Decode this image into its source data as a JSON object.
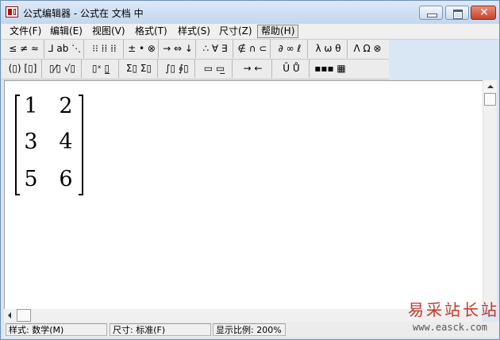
{
  "window": {
    "title": "公式编辑器 - 公式在 文档 中",
    "close_label": "✕"
  },
  "menu": [
    {
      "label": "文件(F)"
    },
    {
      "label": "编辑(E)"
    },
    {
      "label": "视图(V)"
    },
    {
      "label": "格式(T)"
    },
    {
      "label": "样式(S)"
    },
    {
      "label": "尺寸(Z)"
    },
    {
      "label": "帮助(H)"
    }
  ],
  "toolbar_row1": [
    {
      "label": "≤ ≠ ≈"
    },
    {
      "label": "⅃ ab ⋱"
    },
    {
      "label": "⁝⁝ ⁞⁞ ⁞⁞"
    },
    {
      "label": "± • ⊗"
    },
    {
      "label": "→ ⇔ ↓"
    },
    {
      "label": "∴ ∀ ∃"
    },
    {
      "label": "∉ ∩ ⊂"
    },
    {
      "label": "∂ ∞ ℓ"
    },
    {
      "label": "λ ω θ"
    },
    {
      "label": "Λ Ω ⊗"
    }
  ],
  "toolbar_row2": [
    {
      "label": "(▯) [▯]"
    },
    {
      "label": "▯⁄▯ √▯"
    },
    {
      "label": "▯ˣ ▯̲"
    },
    {
      "label": "Σ▯ Σ▯"
    },
    {
      "label": "∫▯ ∮▯"
    },
    {
      "label": "▭ ▭̲"
    },
    {
      "label": "→ ←"
    },
    {
      "label": "Ū Ů"
    },
    {
      "label": "▪▪▪ ▦"
    }
  ],
  "matrix": {
    "rows": [
      [
        "1",
        "2"
      ],
      [
        "3",
        "4"
      ],
      [
        "5",
        "6"
      ]
    ]
  },
  "status": {
    "style": "样式: 数学(M)",
    "size": "尺寸: 标准(F)",
    "zoom": "显示比例: 200%"
  },
  "watermark": {
    "site_cn": "易采站长站",
    "url": "www.easck.com"
  },
  "colors": {
    "accent": "#c0392b",
    "title_bg": "#c3d7ee"
  }
}
